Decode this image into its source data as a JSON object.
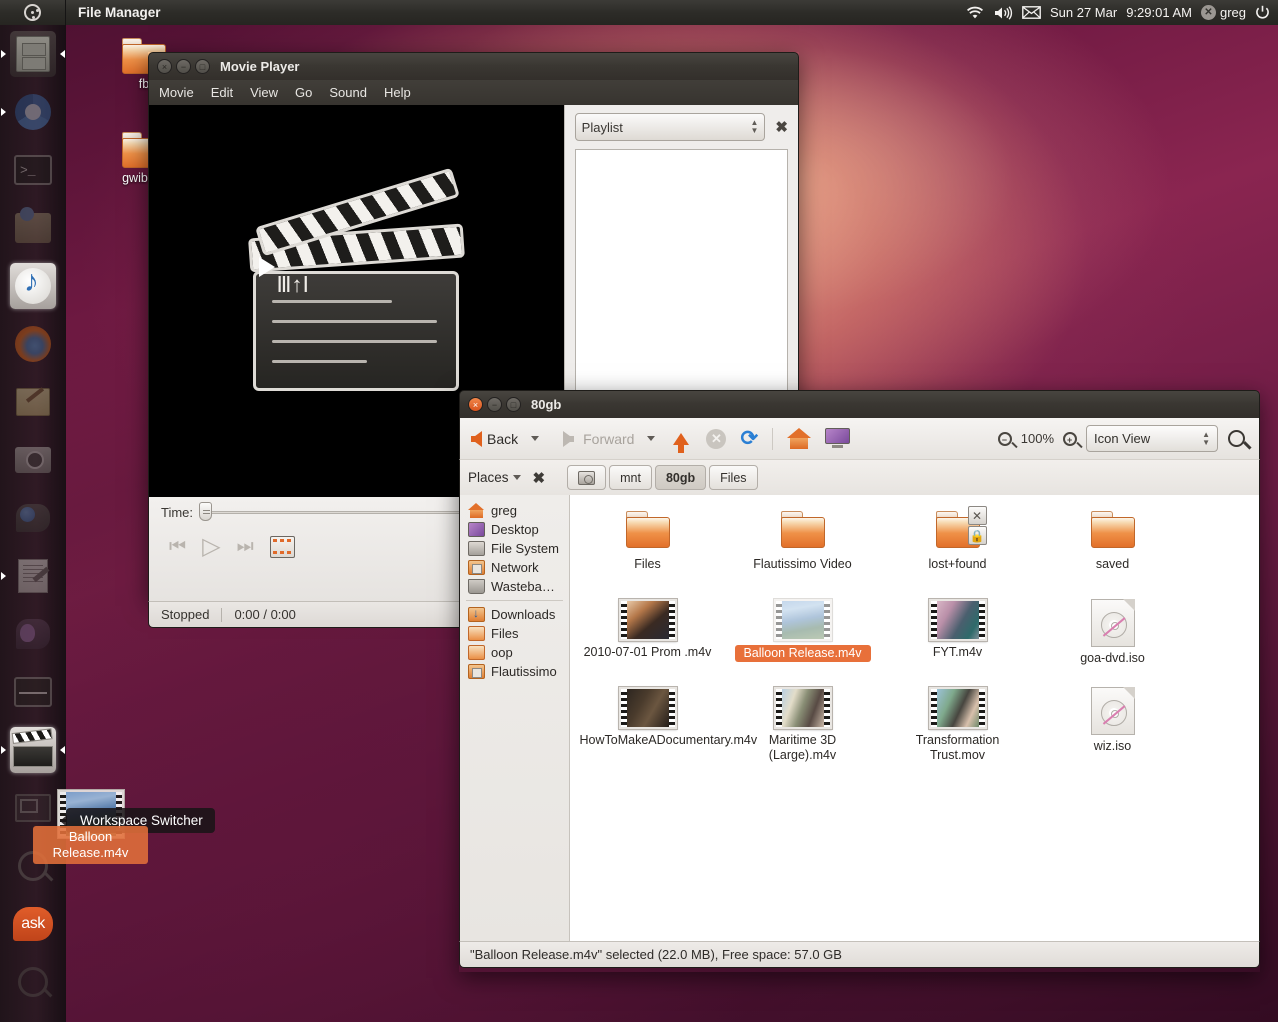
{
  "panel": {
    "app_title": "File Manager",
    "indicators": {
      "wifi_icon": "wifi-icon",
      "volume_icon": "volume-icon",
      "mail_icon": "mail-icon",
      "date": "Sun 27 Mar",
      "time": "9:29:01 AM",
      "user": "greg",
      "user_status_icon": "offline-status-icon",
      "power_icon": "power-icon"
    }
  },
  "launcher": {
    "items": [
      {
        "name": "file-manager",
        "icon": "file-cabinet-icon",
        "state": "running-focused"
      },
      {
        "name": "chromium",
        "icon": "chromium-icon",
        "state": "running"
      },
      {
        "name": "terminal",
        "icon": "terminal-icon",
        "state": "idle"
      },
      {
        "name": "software-center",
        "icon": "software-center-icon",
        "state": "idle"
      },
      {
        "name": "banshee",
        "icon": "banshee-icon",
        "state": "active"
      },
      {
        "name": "firefox",
        "icon": "firefox-icon",
        "state": "idle"
      },
      {
        "name": "notes",
        "icon": "pencil-note-icon",
        "state": "idle"
      },
      {
        "name": "camera",
        "icon": "camera-icon",
        "state": "idle"
      },
      {
        "name": "gwibber",
        "icon": "gwibber-icon",
        "state": "idle"
      },
      {
        "name": "text-editor",
        "icon": "document-pencil-icon",
        "state": "running"
      },
      {
        "name": "pidgin",
        "icon": "pidgin-icon",
        "state": "idle"
      },
      {
        "name": "system-monitor",
        "icon": "system-monitor-icon",
        "state": "idle"
      },
      {
        "name": "movie-player",
        "icon": "clapperboard-icon",
        "state": "running-focused"
      },
      {
        "name": "workspace-switcher",
        "icon": "workspace-switcher-icon",
        "state": "idle"
      },
      {
        "name": "zoom",
        "icon": "magnifier-plus-icon",
        "state": "idle"
      },
      {
        "name": "ask-ubuntu",
        "icon": "ask-icon",
        "label": "ask",
        "state": "idle"
      },
      {
        "name": "dash-search",
        "icon": "magnifier-icon",
        "state": "idle"
      }
    ]
  },
  "desktop_icons": [
    {
      "label": "fb",
      "icon": "folder-icon"
    },
    {
      "label": "gwibber",
      "icon": "folder-icon"
    }
  ],
  "movie_player": {
    "title": "Movie Player",
    "window_buttons": {
      "close": "×",
      "minimize": "−",
      "maximize": "□"
    },
    "menu": [
      "Movie",
      "Edit",
      "View",
      "Go",
      "Sound",
      "Help"
    ],
    "playlist": {
      "selector_value": "Playlist",
      "close_icon": "close-icon",
      "items": []
    },
    "controls": {
      "time_label": "Time:",
      "previous_icon": "previous-track-icon",
      "play_icon": "play-icon",
      "next_icon": "next-track-icon",
      "screenshot_icon": "take-screenshot-icon"
    },
    "status": {
      "state": "Stopped",
      "position": "0:00 / 0:00"
    }
  },
  "file_manager": {
    "title": "80gb",
    "window_buttons": {
      "close": "×",
      "minimize": "−",
      "maximize": "□"
    },
    "toolbar": {
      "back_label": "Back",
      "forward_label": "Forward",
      "up_icon": "arrow-up-icon",
      "stop_icon": "stop-icon",
      "reload_icon": "reload-icon",
      "home_icon": "home-icon",
      "computer_icon": "computer-icon",
      "zoom_out_icon": "zoom-out-icon",
      "zoom_level": "100%",
      "zoom_in_icon": "zoom-in-icon",
      "view_mode": "Icon View",
      "search_icon": "search-icon"
    },
    "pathbar": {
      "places_label": "Places",
      "places_close_icon": "close-icon",
      "crumbs": [
        {
          "label": "",
          "icon": "disk-icon",
          "current": false
        },
        {
          "label": "mnt",
          "icon": "",
          "current": false
        },
        {
          "label": "80gb",
          "icon": "",
          "current": true
        },
        {
          "label": "Files",
          "icon": "",
          "current": false
        }
      ]
    },
    "sidebar": {
      "items": [
        {
          "label": "greg",
          "icon": "home-icon"
        },
        {
          "label": "Desktop",
          "icon": "desktop-icon"
        },
        {
          "label": "File System",
          "icon": "disk-icon"
        },
        {
          "label": "Network",
          "icon": "network-icon"
        },
        {
          "label": "Wasteba…",
          "icon": "trash-icon"
        },
        {
          "label": "Downloads",
          "icon": "downloads-icon",
          "after_separator": true
        },
        {
          "label": "Files",
          "icon": "folder-icon"
        },
        {
          "label": "oop",
          "icon": "folder-icon"
        },
        {
          "label": "Flautissimo",
          "icon": "bookmark-folder-icon"
        }
      ]
    },
    "files": [
      {
        "label": "Files",
        "type": "folder",
        "selected": false
      },
      {
        "label": "Flautissimo Video",
        "type": "folder",
        "selected": false
      },
      {
        "label": "lost+found",
        "type": "folder",
        "selected": false,
        "emblems": [
          "unreadable-emblem",
          "locked-emblem"
        ]
      },
      {
        "label": "saved",
        "type": "folder",
        "selected": false
      },
      {
        "label": "2010-07-01 Prom .m4v",
        "type": "video",
        "selected": false,
        "thumb": "portrait-indoor"
      },
      {
        "label": "Balloon Release.m4v",
        "type": "video",
        "selected": true,
        "dragging": true,
        "thumb": "crowd-outdoor"
      },
      {
        "label": "FYT.m4v",
        "type": "video",
        "selected": false,
        "thumb": "street-people"
      },
      {
        "label": "goa-dvd.iso",
        "type": "iso",
        "selected": false
      },
      {
        "label": "HowToMakeADocumentary.m4v",
        "type": "video",
        "selected": false,
        "thumb": "man-dark-room"
      },
      {
        "label": "Maritime 3D (Large).m4v",
        "type": "video",
        "selected": false,
        "thumb": "man-window"
      },
      {
        "label": "Transformation Trust.mov",
        "type": "video",
        "selected": false,
        "thumb": "man-suit-outside"
      },
      {
        "label": "wiz.iso",
        "type": "iso",
        "selected": false
      }
    ],
    "status_text": "\"Balloon Release.m4v\" selected (22.0 MB), Free space: 57.0 GB"
  },
  "drag": {
    "label": "Balloon Release.m4v",
    "tooltip": "Workspace Switcher"
  },
  "colors": {
    "accent_orange": "#e2702a",
    "selection_orange": "#e8703a",
    "panel_dark": "#2d2c28",
    "launcher_dark": "#241a20"
  }
}
